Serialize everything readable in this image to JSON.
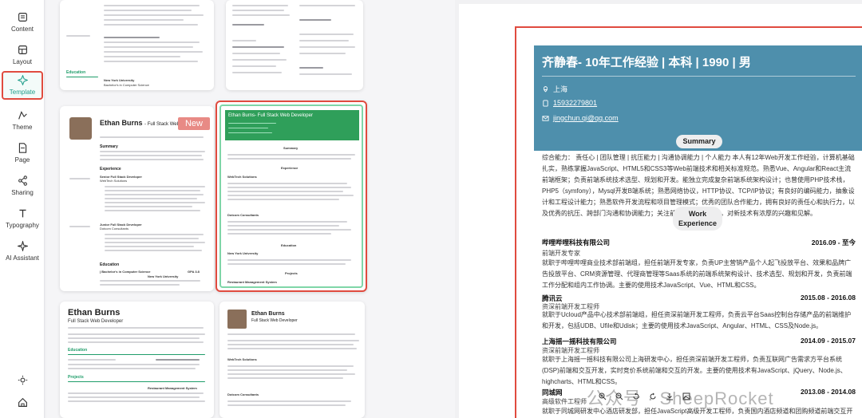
{
  "nav": {
    "items": [
      {
        "label": "Content",
        "icon": "list-icon"
      },
      {
        "label": "Layout",
        "icon": "layout-icon"
      },
      {
        "label": "Template",
        "icon": "template-icon"
      },
      {
        "label": "Theme",
        "icon": "palette-icon"
      },
      {
        "label": "Page",
        "icon": "page-icon"
      },
      {
        "label": "Sharing",
        "icon": "share-icon"
      },
      {
        "label": "Typography",
        "icon": "typography-icon"
      },
      {
        "label": "AI Assistant",
        "icon": "ai-icon"
      }
    ],
    "active": "Template"
  },
  "gallery": {
    "card_a": {
      "education_heading": "Education",
      "school": "New York University",
      "degree": "Bachelor's in Computer Science"
    },
    "card_b": {
      "name": "Ethan Burns",
      "role": "- Full Stack Web Developer",
      "badge": "New",
      "summary": "Summary",
      "experience": "Experience",
      "employer1": "WebTech Solutions",
      "role1": "Senior Full Stack Developer",
      "employer2": "Junior Full Stack Developer",
      "role2": "Dotcom Consultants",
      "education": "Education",
      "degree": "| Bachelor's in Computer Science",
      "school": "New York University",
      "gpa": "GPA 3.8",
      "grad": "Experience"
    },
    "card_c": {
      "title": "Ethan Burns- Full Stack Web Developer",
      "summary": "Summary",
      "experience": "Experience",
      "employer1": "WebTech Solutions",
      "employer2": "Dotcom Consultants",
      "education": "Education",
      "school": "New York University",
      "projects": "Projects",
      "project1": "Restaurant Management System"
    },
    "card_d": {
      "name": "Ethan Burns",
      "role": "Full Stack Web Developer",
      "education": "Education",
      "projects": "Projects",
      "project1": "Restaurant Management System"
    },
    "card_e": {
      "name": "Ethan Burns",
      "role": "Full Stack Web Developer",
      "employer": "WebTech Solutions",
      "employer2": "Dotcom Consultants"
    }
  },
  "resume": {
    "name": "齐静春- 10年工作经验 | 本科 | 1990 | 男",
    "location": "上海",
    "phone": "15932279801",
    "email": "jingchun.qi@qq.com",
    "summary_title": "Summary",
    "summary_text": "综合能力： 责任心 | 团队管理 | 抗压能力 | 沟通协调能力 | 个人能力 本人有12年Web开发工作经验，计算机基础扎实，熟练掌握JavaScript、HTML5和CSS3等Web前端技术和相关标准规范。熟悉Vue、Angular和React主流前端框架；负责前端系统技术选型、规划和开发。能独立完成复杂前端系统架构设计；也曾使用PHP技术栈，PHP5（symfony），Mysql开发B端系统；熟悉网络协议，HTTP协议、TCP/IP协议；有良好的编码能力，抽象设计和工程设计能力；熟悉软件开发流程和项目管理模式；优秀的团队合作能力，拥有良好的责任心和执行力，以及优秀的抗压、跨部门沟通和协调能力；关注前端前沿技术研究，对新技术有浓厚的兴趣和见解。",
    "work_title_1": "Work",
    "work_title_2": "Experience",
    "jobs": [
      {
        "company": "哔哩哔哩科技有限公司",
        "period": "2016.09 - 至今",
        "role": "前端开发专家",
        "desc": "就职于哔哩哔哩商业技术部前端组，担任前端开发专家，负责UP主营销产品个人起飞投放平台、效果和品牌广告投放平台、CRM资源管理、代理商管理等Saas系统的前端系统架构设计、技术选型、规划和开发，负责前端工作分配和组内工作协调。主要的使用技术JavaScript、Vue、HTML和CSS。"
      },
      {
        "company": "腾讯云",
        "period": "2015.08 - 2016.08",
        "role": "资深前端开发工程师",
        "desc": "就职于Ucloud产品中心技术部前端组，担任资深前端开发工程师，负责云平台Saas控制台存储产品的前端维护和开发，包括UDB、Ufile和Udisk；主要的使用技术JavaScript、Angular、HTML、CSS及Node.js。"
      },
      {
        "company": "上海摇一摇科技有限公司",
        "period": "2014.09 - 2015.07",
        "role": "资深前端开发工程师",
        "desc": "就职于上海摇一摇科技有限公司上海研发中心，担任资深前端开发工程师，负责互联网广告需求方平台系统(DSP)前端和交互开发，实时竞价系统前端和交互的开发。主要的使用技术有JavaScript、jQuery、Node.js、highcharts、HTML和CSS。"
      },
      {
        "company": "同城网",
        "period": "2013.08 - 2014.08",
        "role": "高级软件工程师",
        "desc": "就职于同城网研发中心酒店研发部，担任JavaScript高级开发工程师，负责国内酒店频道和团购频道前端交互开发，主要"
      }
    ]
  },
  "watermark": "公众号 · SheepRocket",
  "colors": {
    "accent": "#1f9d8a",
    "highlight": "#e04b3f",
    "header": "#4e8fac",
    "badge": "#e88a85",
    "card_green": "#2f9f5a"
  }
}
